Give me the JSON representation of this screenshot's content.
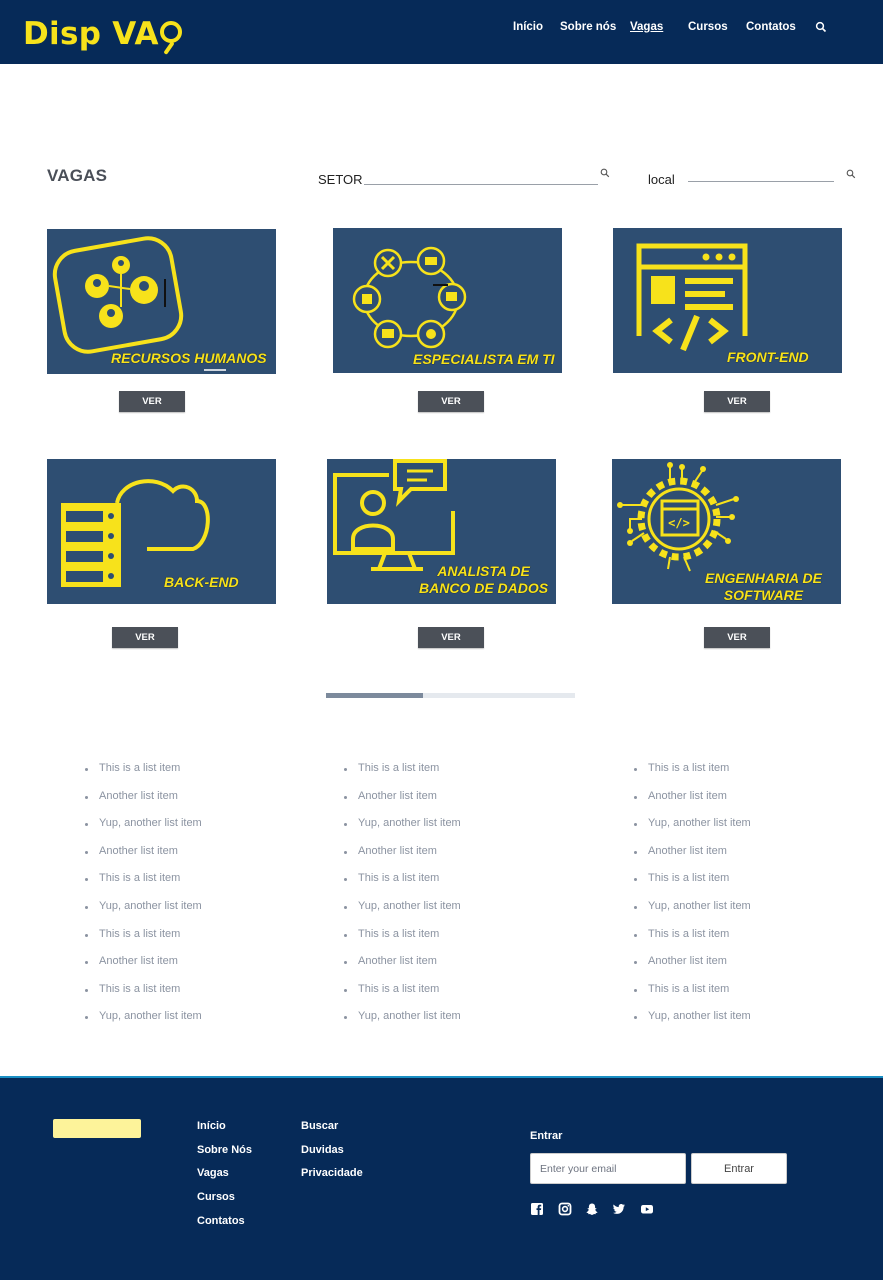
{
  "colors": {
    "brand_blue": "#062a58",
    "brand_yellow": "#f7e21b",
    "card_bg": "#2e4e72",
    "button_gray": "#4b5058",
    "footer_accent": "#1a8fc4"
  },
  "header": {
    "logo_text": "Disp VA",
    "logo_icon": "magnifier-g-icon",
    "nav": [
      {
        "label": "Início",
        "active": false
      },
      {
        "label": "Sobre nós",
        "active": false
      },
      {
        "label": "Vagas",
        "active": true
      },
      {
        "label": "Cursos",
        "active": false
      },
      {
        "label": "Contatos",
        "active": false
      }
    ],
    "search_icon": "search-icon"
  },
  "main": {
    "title": "VAGAS",
    "filters": {
      "setor_label": "SETOR",
      "local_label": "local"
    },
    "cards": [
      {
        "caption_lines": [
          "RECURSOS HUMANOS"
        ],
        "button": "VER",
        "icon": "people-network-icon"
      },
      {
        "caption_lines": [
          "ESPECIALISTA EM TI"
        ],
        "button": "VER",
        "icon": "it-tools-cycle-icon"
      },
      {
        "caption_lines": [
          "FRONT-END"
        ],
        "button": "VER",
        "icon": "browser-code-icon"
      },
      {
        "caption_lines": [
          "BACK-END"
        ],
        "button": "VER",
        "icon": "server-cloud-icon"
      },
      {
        "caption_lines": [
          "ANALISTA DE",
          "BANCO DE DADOS"
        ],
        "button": "VER",
        "icon": "monitor-person-chat-icon"
      },
      {
        "caption_lines": [
          "ENGENHARIA DE",
          "SOFTWARE"
        ],
        "button": "VER",
        "icon": "code-gear-circuit-icon"
      }
    ],
    "pager_progress": 0.39
  },
  "lists": [
    [
      "This is a list item",
      "Another list item",
      "Yup, another list item",
      "Another list item",
      "This is a list item",
      "Yup, another list item",
      "This is a list item",
      "Another list item",
      "This is a list item",
      "Yup, another list item"
    ],
    [
      "This is a list item",
      "Another list item",
      "Yup, another list item",
      "Another list item",
      "This is a list item",
      "Yup, another list item",
      "This is a list item",
      "Another list item",
      "This is a list item",
      "Yup, another list item"
    ],
    [
      "This is a list item",
      "Another list item",
      "Yup, another list item",
      "Another list item",
      "This is a list item",
      "Yup, another list item",
      "This is a list item",
      "Another list item",
      "This is a list item",
      "Yup, another list item"
    ]
  ],
  "footer": {
    "col1": [
      "Início",
      "Sobre Nós",
      "Vagas",
      "Cursos",
      "Contatos"
    ],
    "col2": [
      "Buscar",
      "Duvidas",
      "Privacidade"
    ],
    "entrar_title": "Entrar",
    "email_placeholder": "Enter your email",
    "entrar_button": "Entrar",
    "social_icons": [
      "facebook-icon",
      "instagram-icon",
      "snapchat-icon",
      "twitter-icon",
      "youtube-icon"
    ]
  }
}
